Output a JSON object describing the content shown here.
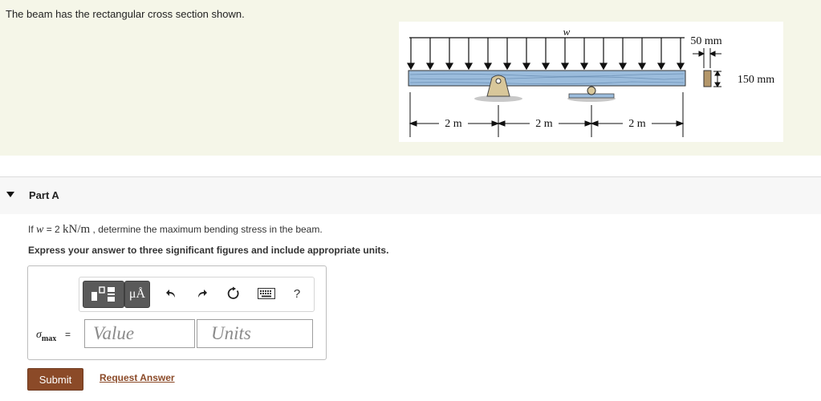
{
  "intro": {
    "text": "The beam has the rectangular cross section shown."
  },
  "figure": {
    "load_label": "w",
    "span_labels": [
      "2 m",
      "2 m",
      "2 m"
    ],
    "width_label": "50 mm",
    "height_label": "150 mm"
  },
  "part": {
    "title": "Part A",
    "question_prefix": "If ",
    "question_var": "w",
    "question_mid": " = 2 ",
    "question_qty": "kN/m",
    "question_suffix": " , determine the maximum bending stress in the beam.",
    "instruction": "Express your answer to three significant figures and include appropriate units."
  },
  "toolbar": {
    "units_label": "μÅ",
    "undo_icon": "undo-icon",
    "redo_icon": "redo-icon",
    "reset_icon": "reset-icon",
    "keyboard_icon": "keyboard-icon",
    "help_label": "?"
  },
  "answer": {
    "symbol": "σ",
    "subscript": "max",
    "equals": "=",
    "value_placeholder": "Value",
    "units_placeholder": "Units"
  },
  "actions": {
    "submit_label": "Submit",
    "request_label": "Request Answer"
  },
  "colors": {
    "intro_bg": "#f5f6e8",
    "beam": "#9bbcdc",
    "support": "#d8c79a",
    "submit": "#8b4a28"
  }
}
